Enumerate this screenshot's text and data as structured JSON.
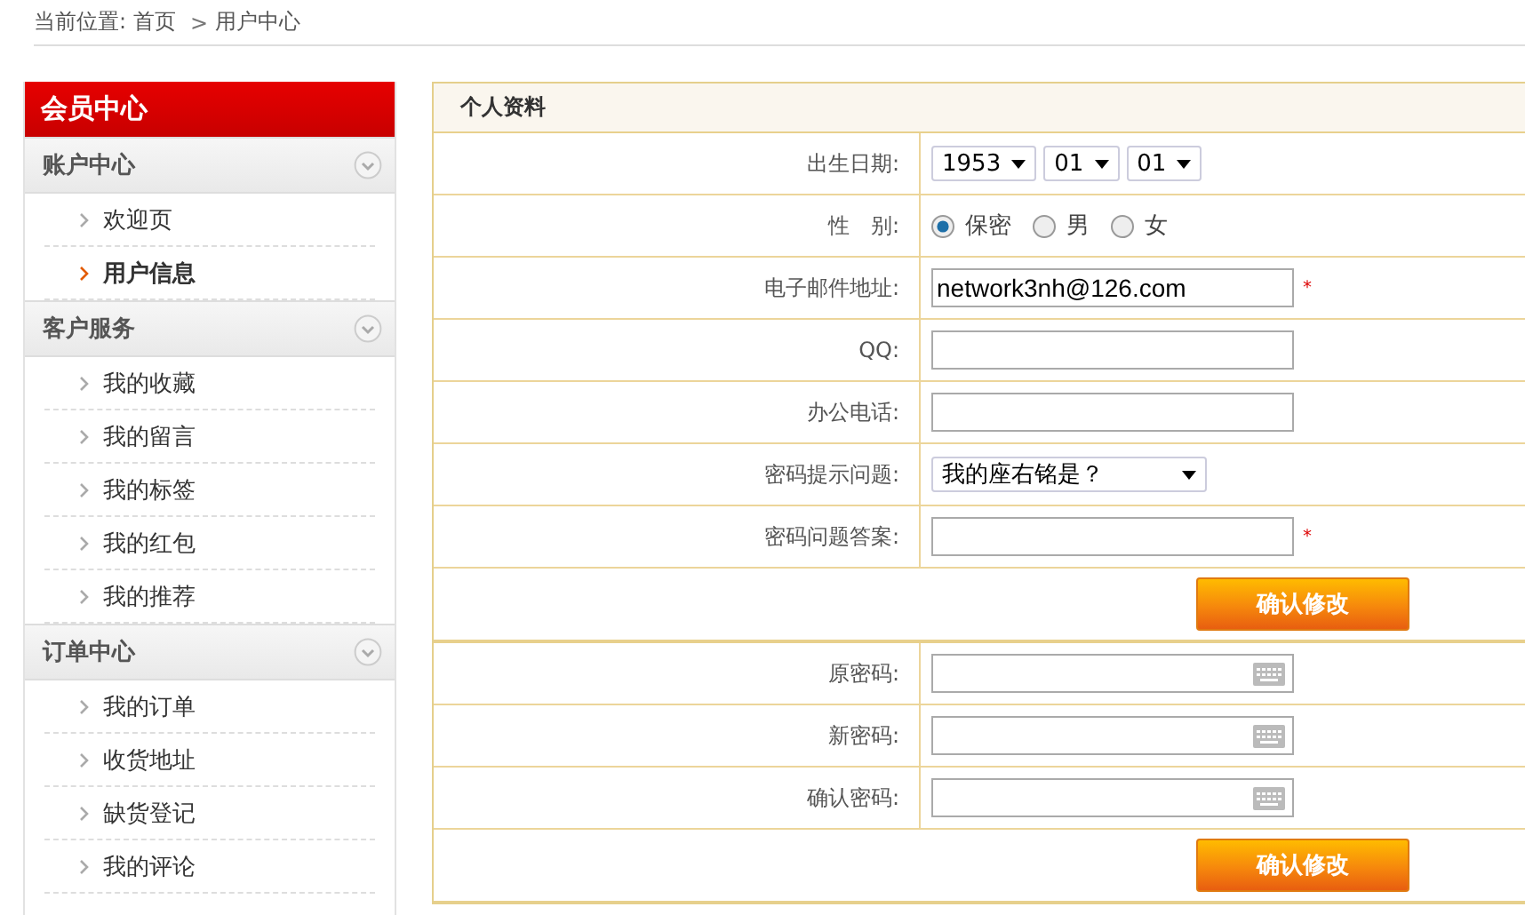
{
  "breadcrumb": {
    "label": "当前位置:",
    "links": [
      "首页",
      "用户中心"
    ],
    "separator": ">"
  },
  "sidebar": {
    "title": "会员中心",
    "sections": [
      {
        "title": "账户中心",
        "expanded": true,
        "items": [
          {
            "label": "欢迎页",
            "selected": false
          },
          {
            "label": "用户信息",
            "selected": true
          }
        ]
      },
      {
        "title": "客户服务",
        "expanded": true,
        "items": [
          {
            "label": "我的收藏",
            "selected": false
          },
          {
            "label": "我的留言",
            "selected": false
          },
          {
            "label": "我的标签",
            "selected": false
          },
          {
            "label": "我的红包",
            "selected": false
          },
          {
            "label": "我的推荐",
            "selected": false
          }
        ]
      },
      {
        "title": "订单中心",
        "expanded": true,
        "items": [
          {
            "label": "我的订单",
            "selected": false
          },
          {
            "label": "收货地址",
            "selected": false
          },
          {
            "label": "缺货登记",
            "selected": false
          },
          {
            "label": "我的评论",
            "selected": false
          }
        ]
      }
    ]
  },
  "panel": {
    "title": "个人资料",
    "groups": [
      {
        "rows": [
          {
            "kind": "date",
            "label": "出生日期:",
            "values": [
              "1953",
              "01",
              "01"
            ]
          },
          {
            "kind": "radio",
            "label": "性　别:",
            "options": [
              {
                "label": "保密",
                "selected": true
              },
              {
                "label": "男",
                "selected": false
              },
              {
                "label": "女",
                "selected": false
              }
            ]
          },
          {
            "kind": "text",
            "label": "电子邮件地址:",
            "value": "network3nh@126.com",
            "mark": "*"
          },
          {
            "kind": "text",
            "label": "QQ:",
            "value": ""
          },
          {
            "kind": "text",
            "label": "办公电话:",
            "value": ""
          },
          {
            "kind": "select",
            "label": "密码提示问题:",
            "value": "我的座右铭是？"
          },
          {
            "kind": "text",
            "label": "密码问题答案:",
            "value": "",
            "mark": "*"
          }
        ],
        "button": "确认修改"
      },
      {
        "rows": [
          {
            "kind": "password",
            "label": "原密码:"
          },
          {
            "kind": "password",
            "label": "新密码:"
          },
          {
            "kind": "password",
            "label": "确认密码:"
          }
        ],
        "button": "确认修改"
      }
    ]
  }
}
